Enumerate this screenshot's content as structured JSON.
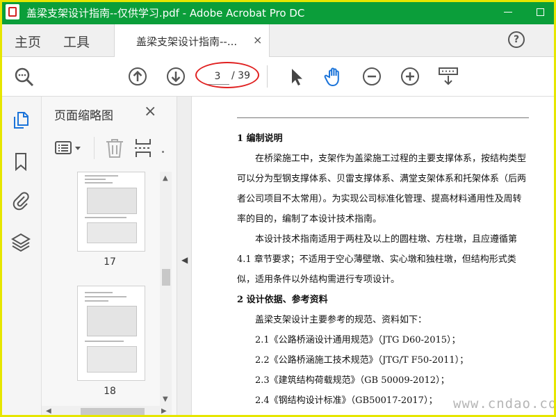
{
  "window": {
    "title": "盖梁支架设计指南--仅供学习.pdf - Adobe Acrobat Pro DC"
  },
  "tabs": {
    "home": "主页",
    "tools": "工具",
    "document": "盖梁支架设计指南--...",
    "document_close": "×",
    "help": "?"
  },
  "toolbar": {
    "current_page": "3",
    "total_pages": "/ 39"
  },
  "thumbnails_panel": {
    "title": "页面缩略图",
    "close": "×",
    "pages": [
      {
        "label": "17"
      },
      {
        "label": "18"
      }
    ]
  },
  "document": {
    "paragraphs": [
      {
        "text": "1 编制说明",
        "style": "heading"
      },
      {
        "text": "在桥梁施工中，支架作为盖梁施工过程的主要支撑体系，按结构类型可以分为型钢支撑体系、贝雷支撑体系、满堂支架体系和托架体系（后两者公司项目不太常用）。为实现公司标准化管理、提高材料通用性及周转率的目的，编制了本设计技术指南。",
        "style": "indent"
      },
      {
        "text": "本设计技术指南适用于两柱及以上的圆柱墩、方柱墩，且应遵循第 4.1 章节要求；不适用于空心薄壁墩、实心墩和独柱墩，但结构形式类似，适用条件以外结构需进行专项设计。",
        "style": "indent"
      },
      {
        "text": "2 设计依据、参考资料",
        "style": "heading"
      },
      {
        "text": "盖梁支架设计主要参考的规范、资料如下：",
        "style": "indent"
      },
      {
        "text": "2.1《公路桥涵设计通用规范》（JTG D60-2015）；",
        "style": "indent"
      },
      {
        "text": "2.2《公路桥涵施工技术规范》（JTG/T F50-2011）；",
        "style": "indent"
      },
      {
        "text": "2.3《建筑结构荷载规范》（GB 50009-2012）；",
        "style": "indent"
      },
      {
        "text": "2.4《钢结构设计标准》（GB50017-2017）；",
        "style": "indent"
      }
    ]
  },
  "watermark": "www.cndao.com",
  "colors": {
    "titlebar": "#0b9e3a",
    "annotation_ellipse": "#e02020",
    "frame": "#e6e600"
  }
}
